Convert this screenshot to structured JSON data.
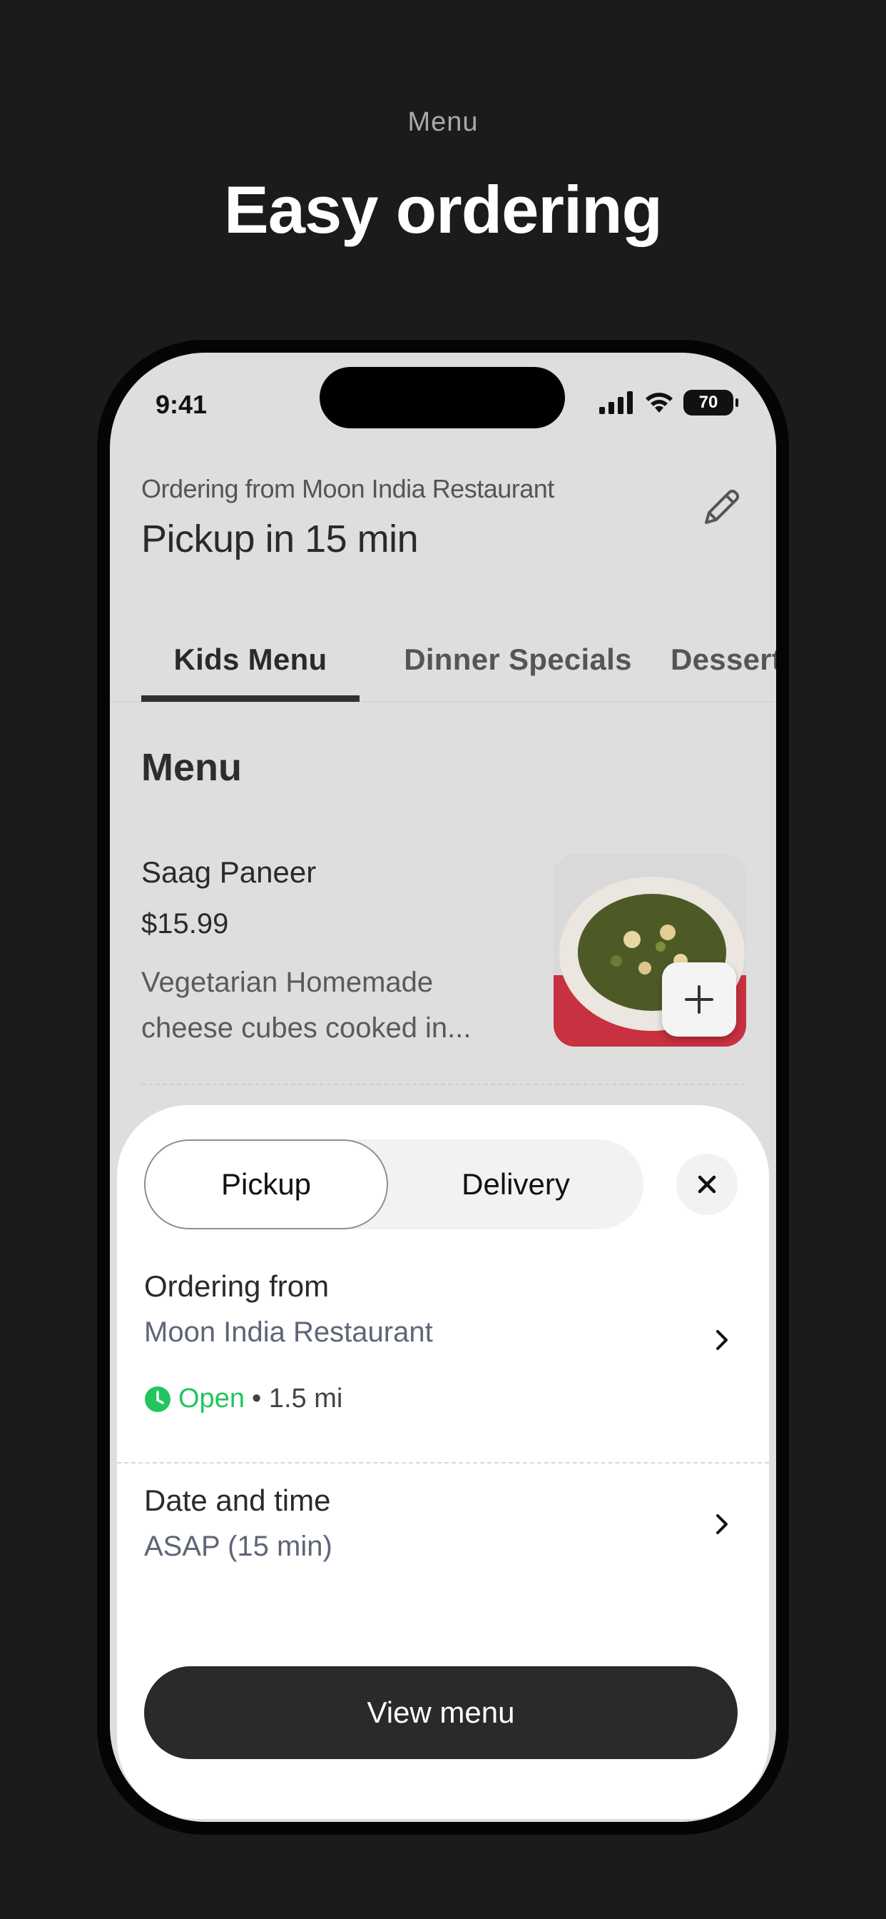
{
  "promo": {
    "kicker": "Menu",
    "title": "Easy ordering"
  },
  "status_bar": {
    "time": "9:41",
    "battery": "70",
    "icons": [
      "cellular-signal-icon",
      "wifi-icon",
      "battery-icon"
    ]
  },
  "header": {
    "ordering_from": "Ordering from Moon India Restaurant",
    "pickup_time": "Pickup in 15 min",
    "edit_icon": "pencil-icon"
  },
  "tabs": [
    {
      "label": "Kids Menu",
      "active": true
    },
    {
      "label": "Dinner Specials",
      "active": false
    },
    {
      "label": "Desserts",
      "active": false
    }
  ],
  "menu": {
    "heading": "Menu",
    "items": [
      {
        "name": "Saag Paneer",
        "price": "$15.99",
        "description": "Vegetarian Homemade cheese cubes cooked in...",
        "add_icon": "plus-icon"
      }
    ]
  },
  "sheet": {
    "mode_options": [
      "Pickup",
      "Delivery"
    ],
    "selected_mode": "Pickup",
    "close_icon": "close-icon",
    "ordering_from": {
      "title": "Ordering from",
      "restaurant": "Moon India Restaurant",
      "status": "Open",
      "distance": "• 1.5 mi"
    },
    "date_time": {
      "title": "Date and time",
      "value": "ASAP (15 min)"
    },
    "cta": "View menu"
  },
  "colors": {
    "background": "#1b1b1b",
    "open_green": "#22c55e",
    "button_dark": "#2a2a2a"
  }
}
